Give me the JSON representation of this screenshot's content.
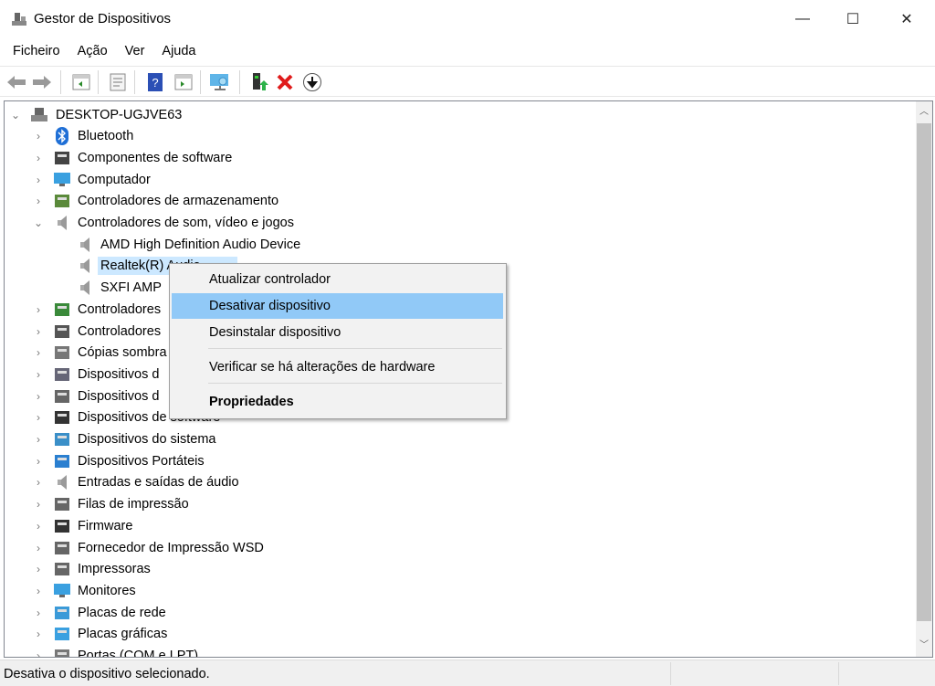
{
  "window": {
    "title": "Gestor de Dispositivos",
    "minimize": "—",
    "maximize": "☐",
    "close": "✕"
  },
  "menu": [
    "Ficheiro",
    "Ação",
    "Ver",
    "Ajuda"
  ],
  "toolbar": [
    "back",
    "forward",
    "show-hide-console-tree",
    "properties",
    "help",
    "action-pane",
    "scan-hardware",
    "update-driver",
    "uninstall",
    "disable"
  ],
  "tree": {
    "root": "DESKTOP-UGJVE63",
    "items": [
      {
        "label": "Bluetooth",
        "icon": "bluetooth-icon",
        "expanded": false
      },
      {
        "label": "Componentes de software",
        "icon": "software-component-icon",
        "expanded": false
      },
      {
        "label": "Computador",
        "icon": "computer-icon",
        "expanded": false
      },
      {
        "label": "Controladores de armazenamento",
        "icon": "storage-controller-icon",
        "expanded": false
      },
      {
        "label": "Controladores de som, vídeo e jogos",
        "icon": "speaker-icon",
        "expanded": true,
        "children": [
          {
            "label": "AMD High Definition Audio Device",
            "icon": "speaker-icon"
          },
          {
            "label": "Realtek(R) Audio",
            "icon": "speaker-icon",
            "selected": true
          },
          {
            "label": "SXFI AMP",
            "icon": "speaker-icon"
          }
        ]
      },
      {
        "label": "Controladores",
        "icon": "ide-controller-icon",
        "expanded": false
      },
      {
        "label": "Controladores",
        "icon": "usb-icon",
        "expanded": false
      },
      {
        "label": "Cópias sombra",
        "icon": "drive-icon",
        "expanded": false
      },
      {
        "label": "Dispositivos d",
        "icon": "hid-icon",
        "expanded": false
      },
      {
        "label": "Dispositivos d",
        "icon": "memory-device-icon",
        "expanded": false
      },
      {
        "label": "Dispositivos de software",
        "icon": "software-device-icon",
        "expanded": false
      },
      {
        "label": "Dispositivos do sistema",
        "icon": "system-device-icon",
        "expanded": false
      },
      {
        "label": "Dispositivos Portáteis",
        "icon": "portable-device-icon",
        "expanded": false
      },
      {
        "label": "Entradas e saídas de áudio",
        "icon": "speaker-icon",
        "expanded": false
      },
      {
        "label": "Filas de impressão",
        "icon": "printer-icon",
        "expanded": false
      },
      {
        "label": "Firmware",
        "icon": "firmware-icon",
        "expanded": false
      },
      {
        "label": "Fornecedor de Impressão WSD",
        "icon": "printer-icon",
        "expanded": false
      },
      {
        "label": "Impressoras",
        "icon": "printer-icon",
        "expanded": false
      },
      {
        "label": "Monitores",
        "icon": "monitor-icon",
        "expanded": false
      },
      {
        "label": "Placas de rede",
        "icon": "network-adapter-icon",
        "expanded": false
      },
      {
        "label": "Placas gráficas",
        "icon": "display-adapter-icon",
        "expanded": false
      },
      {
        "label": "Portas (COM e LPT)",
        "icon": "port-icon",
        "expanded": false
      }
    ]
  },
  "context_menu": [
    {
      "label": "Atualizar controlador"
    },
    {
      "label": "Desativar dispositivo",
      "highlighted": true
    },
    {
      "label": "Desinstalar dispositivo"
    },
    {
      "label": "Verificar se há alterações de hardware"
    },
    {
      "label": "Propriedades",
      "bold": true
    }
  ],
  "status": "Desativa o dispositivo selecionado.",
  "colors": {
    "selection": "#cce8ff",
    "menu_highlight": "#91c9f7"
  }
}
